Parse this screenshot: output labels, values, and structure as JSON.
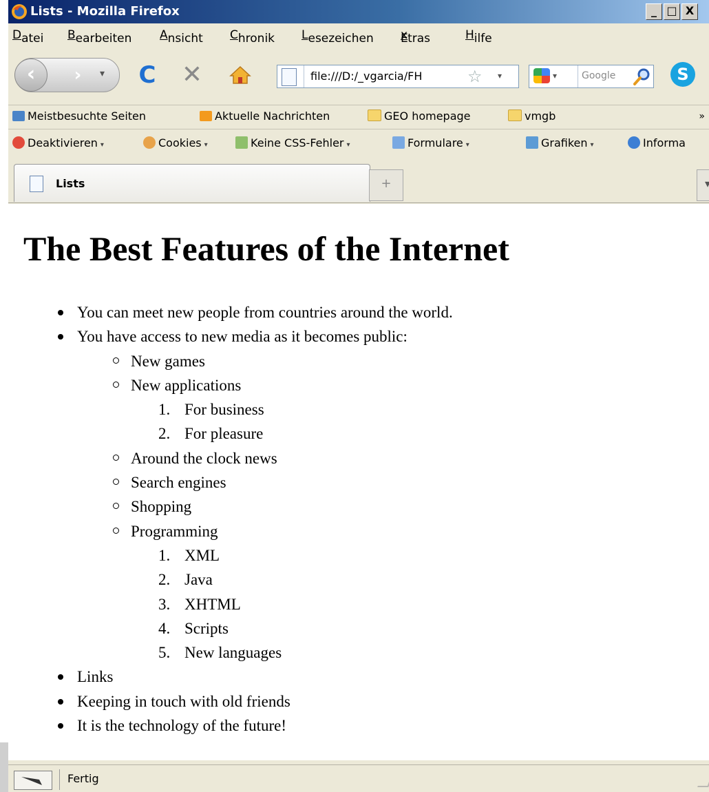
{
  "window": {
    "title": "Lists - Mozilla Firefox",
    "minimize": "_",
    "maximize": "□",
    "close": "X"
  },
  "menu": [
    {
      "pre": "",
      "u": "D",
      "post": "atei"
    },
    {
      "pre": "",
      "u": "B",
      "post": "earbeiten"
    },
    {
      "pre": "",
      "u": "A",
      "post": "nsicht"
    },
    {
      "pre": "",
      "u": "C",
      "post": "hronik"
    },
    {
      "pre": "",
      "u": "L",
      "post": "esezeichen"
    },
    {
      "pre": "E",
      "u": "x",
      "post": "tras"
    },
    {
      "pre": "",
      "u": "H",
      "post": "ilfe"
    }
  ],
  "navigation": {
    "url": "file:///D:/_vgarcia/FH",
    "search_placeholder": "Google"
  },
  "bookmarks": [
    "Meistbesuchte Seiten",
    "Aktuelle Nachrichten",
    "GEO homepage",
    "vmgb"
  ],
  "bookmarks_overflow": "»",
  "devtoolbar": [
    "Deaktivieren",
    "Cookies",
    "Keine CSS-Fehler",
    "Formulare",
    "Grafiken",
    "Informa"
  ],
  "tab": {
    "label": "Lists",
    "new_tab": "+"
  },
  "page": {
    "heading": "The Best Features of the Internet",
    "items": [
      "You can meet new people from countries around the world.",
      "You have access to new media as it becomes public:",
      "Links",
      "Keeping in touch with old friends",
      "It is the technology of the future!"
    ],
    "media": [
      "New games",
      "New applications",
      "Around the clock news",
      "Search engines",
      "Shopping",
      "Programming"
    ],
    "applications": [
      "For business",
      "For pleasure"
    ],
    "programming": [
      "XML",
      "Java",
      "XHTML",
      "Scripts",
      "New languages"
    ]
  },
  "status": {
    "text": "Fertig"
  },
  "colors": {
    "titlebar": "#0a246a",
    "chrome": "#ece9d8",
    "reload": "#1f6fd1"
  }
}
